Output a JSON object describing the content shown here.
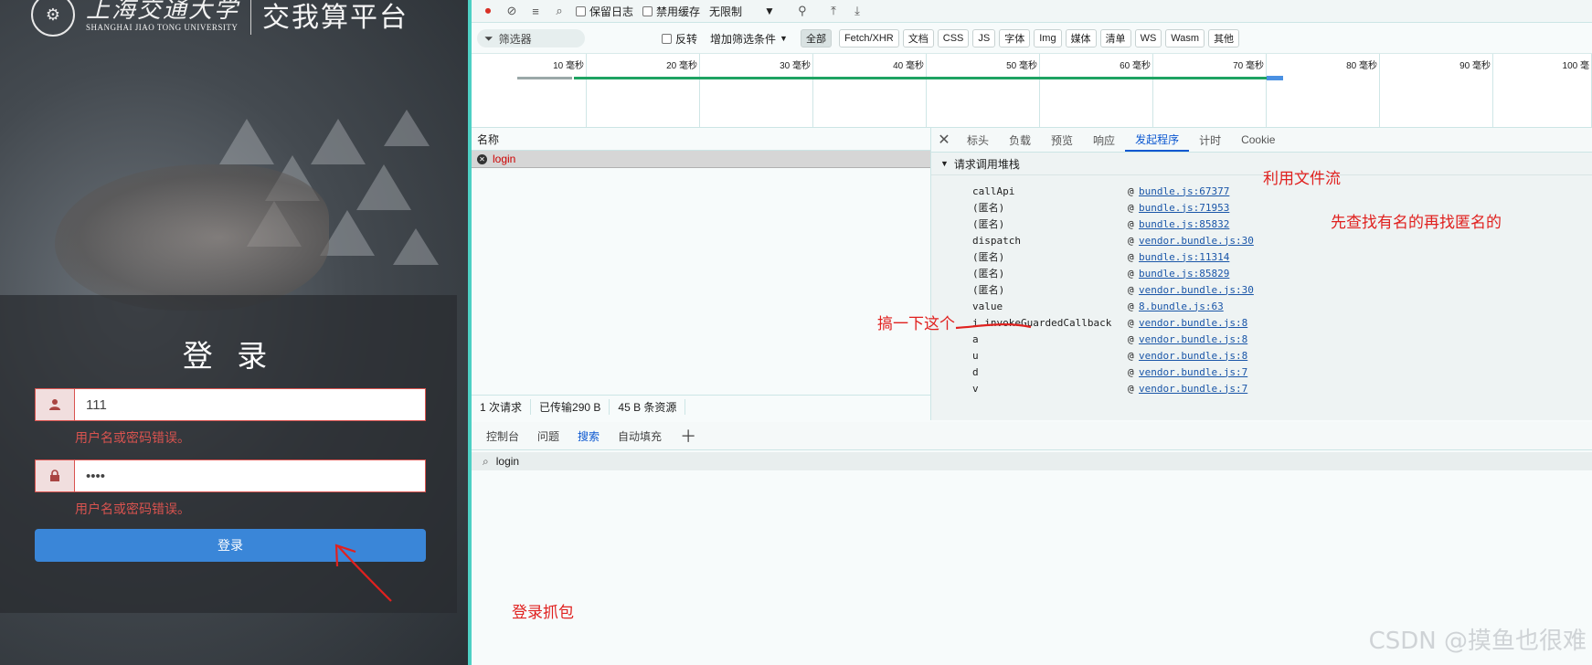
{
  "login_page": {
    "university_cn": "上海交通大学",
    "university_en": "SHANGHAI JIAO TONG UNIVERSITY",
    "platform_title": "交我算平台",
    "form_title": "登 录",
    "username_value": "111",
    "username_error": "用户名或密码错误。",
    "password_value": "••••",
    "password_error": "用户名或密码错误。",
    "login_button": "登录"
  },
  "toolbar": {
    "preserve_log": "保留日志",
    "disable_cache": "禁用缓存",
    "throttle": "无限制"
  },
  "filter_bar": {
    "filter_placeholder": "筛选器",
    "invert": "反转",
    "more_filters": "增加筛选条件",
    "types": [
      "全部",
      "Fetch/XHR",
      "文档",
      "CSS",
      "JS",
      "字体",
      "Img",
      "媒体",
      "清单",
      "WS",
      "Wasm",
      "其他"
    ],
    "active_type": "全部"
  },
  "timeline": {
    "ticks": [
      "10 毫秒",
      "20 毫秒",
      "30 毫秒",
      "40 毫秒",
      "50 毫秒",
      "60 毫秒",
      "70 毫秒",
      "80 毫秒",
      "90 毫秒",
      "100 毫"
    ]
  },
  "request_list": {
    "column_name": "名称",
    "rows": [
      {
        "name": "login"
      }
    ]
  },
  "status_bar": {
    "requests": "1 次请求",
    "transferred": "已传输290 B",
    "resources": "45 B 条资源"
  },
  "detail": {
    "tabs": [
      "标头",
      "负载",
      "预览",
      "响应",
      "发起程序",
      "计时",
      "Cookie"
    ],
    "active_tab": "发起程序",
    "stack_title": "请求调用堆栈",
    "frames": [
      {
        "fn": "callApi",
        "loc": "bundle.js:67377"
      },
      {
        "fn": "(匿名)",
        "loc": "bundle.js:71953"
      },
      {
        "fn": "(匿名)",
        "loc": "bundle.js:85832"
      },
      {
        "fn": "dispatch",
        "loc": "vendor.bundle.js:30"
      },
      {
        "fn": "(匿名)",
        "loc": "bundle.js:11314"
      },
      {
        "fn": "(匿名)",
        "loc": "bundle.js:85829"
      },
      {
        "fn": "(匿名)",
        "loc": "vendor.bundle.js:30"
      },
      {
        "fn": "value",
        "loc": "8.bundle.js:63"
      },
      {
        "fn": "i.invokeGuardedCallback",
        "loc": "vendor.bundle.js:8"
      },
      {
        "fn": "a",
        "loc": "vendor.bundle.js:8"
      },
      {
        "fn": "u",
        "loc": "vendor.bundle.js:8"
      },
      {
        "fn": "d",
        "loc": "vendor.bundle.js:7"
      },
      {
        "fn": "v",
        "loc": "vendor.bundle.js:7"
      }
    ]
  },
  "drawer": {
    "tabs": [
      "控制台",
      "问题",
      "搜索",
      "自动填充"
    ],
    "active_tab": "搜索",
    "search_value": "login"
  },
  "annotations": {
    "use_file_stream": "利用文件流",
    "find_named_first": "先查找有名的再找匿名的",
    "do_this_one": "搞一下这个",
    "login_capture": "登录抓包"
  },
  "watermark": "CSDN @摸鱼也很难",
  "colors": {
    "accent_blue": "#0b57d0",
    "error_red": "#d9534f",
    "annotation_red": "#e0211f",
    "login_button": "#3a86d8"
  }
}
